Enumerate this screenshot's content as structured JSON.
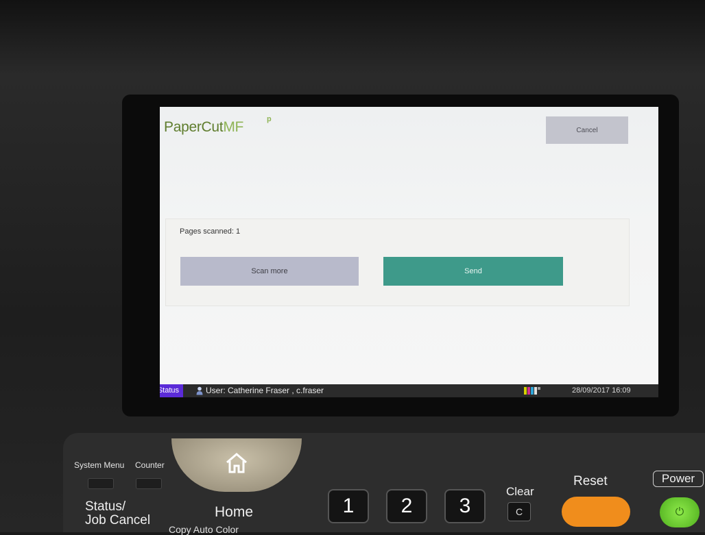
{
  "screen": {
    "logo": {
      "brand": "PaperCut",
      "suffix": "MF",
      "mark": "p"
    },
    "cancel_label": "Cancel",
    "panel": {
      "pages_scanned": "Pages scanned: 1",
      "scan_more_label": "Scan more",
      "send_label": "Send"
    },
    "statusbar": {
      "status_label": "Status",
      "user_icon": "user-icon",
      "user_text": "User: Catherine Fraser , c.fraser",
      "toner_icon": "toner-icon",
      "datetime": "28/09/2017 16:09"
    }
  },
  "hardware": {
    "system_menu_label": "System Menu",
    "counter_label": "Counter",
    "status_job_cancel_label": "Status/",
    "status_job_cancel_label2": "Job Cancel",
    "home_icon": "home-icon",
    "home_label": "Home",
    "copy_label": "Copy   Auto Color",
    "num_keys": [
      "1",
      "2",
      "3"
    ],
    "clear_label": "Clear",
    "clear_key": "C",
    "reset_label": "Reset",
    "power_label": "Power",
    "power_icon": "power-icon"
  },
  "colors": {
    "logo_dark": "#5f7d2e",
    "logo_light": "#8fb456",
    "cancel_bg": "#c3c4cd",
    "scan_more_bg": "#b8bacb",
    "send_bg": "#3e9a8a",
    "status_tab": "#5b2bd8",
    "reset": "#f08d1c",
    "power": "#6fd13a"
  }
}
